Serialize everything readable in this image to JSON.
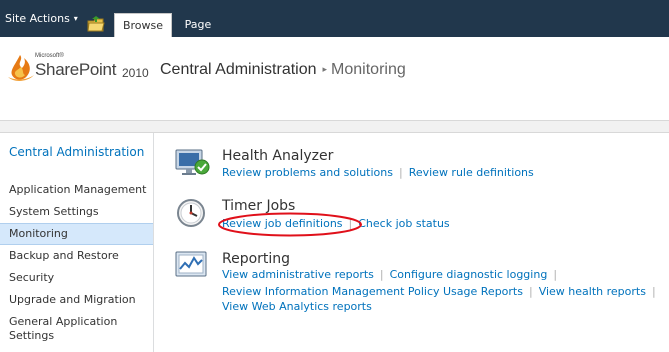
{
  "ribbon": {
    "site_actions_label": "Site Actions",
    "site_actions_caret": "▾",
    "tabs": [
      {
        "label": "Browse",
        "selected": true
      },
      {
        "label": "Page",
        "selected": false
      }
    ]
  },
  "logo": {
    "company": "Microsoft®",
    "product": "SharePoint",
    "version": "2010"
  },
  "breadcrumb": {
    "root": "Central Administration",
    "separator": "▸",
    "current": "Monitoring"
  },
  "leftnav": {
    "header": "Central Administration",
    "items": [
      {
        "label": "Application Management"
      },
      {
        "label": "System Settings"
      },
      {
        "label": "Monitoring",
        "selected": true
      },
      {
        "label": "Backup and Restore"
      },
      {
        "label": "Security"
      },
      {
        "label": "Upgrade and Migration"
      },
      {
        "label": "General Application Settings"
      }
    ]
  },
  "sections": {
    "health_analyzer": {
      "title": "Health Analyzer",
      "links": [
        "Review problems and solutions",
        "Review rule definitions"
      ]
    },
    "timer_jobs": {
      "title": "Timer Jobs",
      "links": [
        "Review job definitions",
        "Check job status"
      ]
    },
    "reporting": {
      "title": "Reporting",
      "links_row1": [
        "View administrative reports",
        "Configure diagnostic logging"
      ],
      "links_row2": [
        "Review Information Management Policy Usage Reports",
        "View health reports"
      ],
      "links_row3": [
        "View Web Analytics reports"
      ]
    }
  },
  "colors": {
    "ribbon_bg": "#21374c",
    "link": "#0072bc",
    "annotation": "#e0101a",
    "nav_selected": "#d5e8fb"
  }
}
